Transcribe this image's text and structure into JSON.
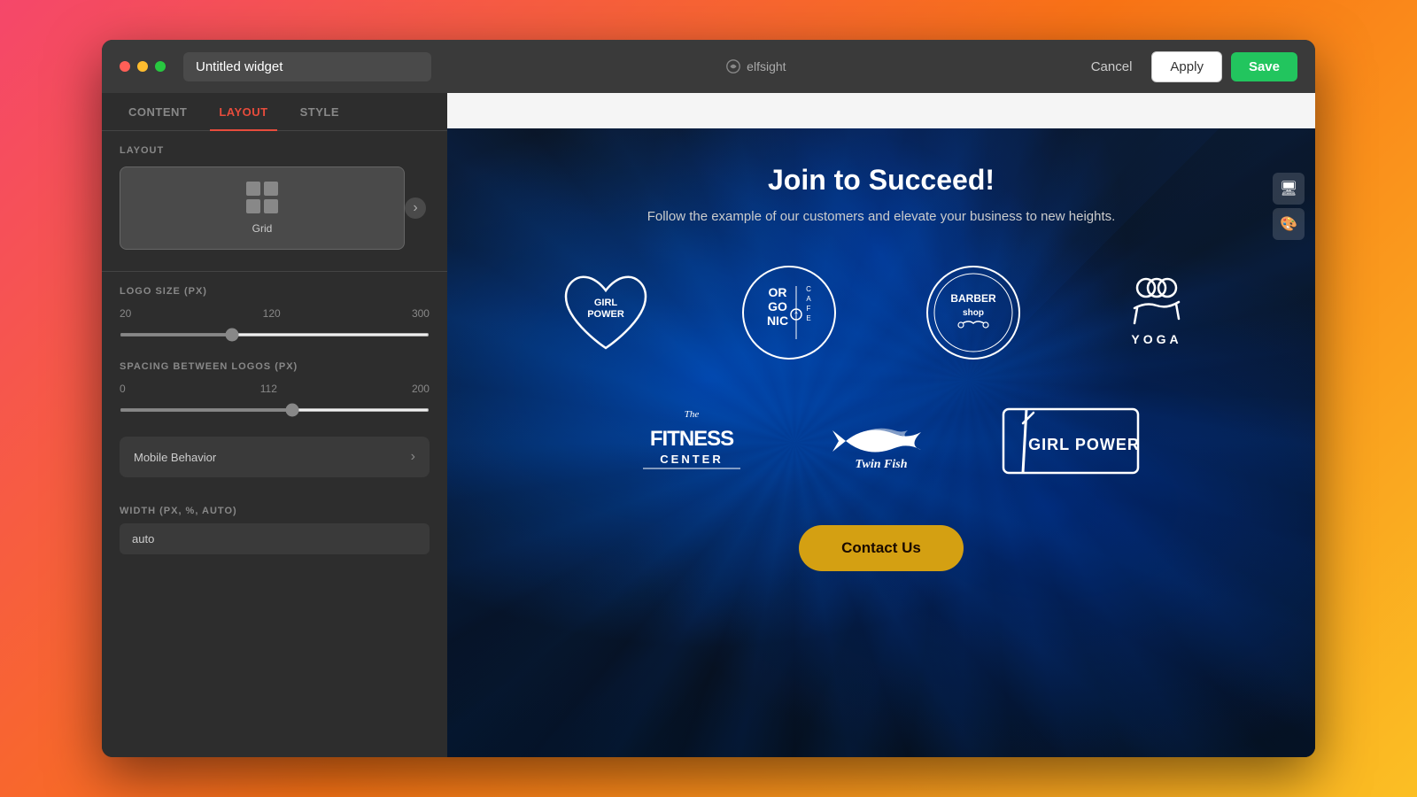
{
  "window": {
    "traffic_lights": [
      "close",
      "minimize",
      "fullscreen"
    ]
  },
  "header": {
    "widget_title": "Untitled widget",
    "widget_title_placeholder": "Untitled widget",
    "brand_name": "elfsight",
    "cancel_label": "Cancel",
    "apply_label": "Apply",
    "save_label": "Save"
  },
  "sidebar": {
    "tabs": [
      {
        "id": "content",
        "label": "CONTENT",
        "active": false
      },
      {
        "id": "layout",
        "label": "LAYOUT",
        "active": true
      },
      {
        "id": "style",
        "label": "STYLE",
        "active": false
      }
    ],
    "layout_section": {
      "label": "LAYOUT",
      "options": [
        {
          "id": "grid",
          "label": "Grid",
          "selected": true
        }
      ]
    },
    "logo_size": {
      "label": "LOGO SIZE (PX)",
      "min": 20,
      "current": 120,
      "max": 300
    },
    "spacing": {
      "label": "SPACING BETWEEN LOGOS (PX)",
      "min": 0,
      "current": 112,
      "max": 200
    },
    "mobile_behavior": {
      "label": "Mobile Behavior"
    },
    "width": {
      "label": "WIDTH (PX, %, AUTO)",
      "value": "auto"
    }
  },
  "preview": {
    "top_bar_bg": "#f5f5f5",
    "title": "Join to Succeed!",
    "subtitle": "Follow the example of our customers and elevate your business to new heights.",
    "contact_button": "Contact Us",
    "logos": [
      {
        "name": "Girl Power",
        "type": "heart-logo"
      },
      {
        "name": "Organic Cafe",
        "type": "organic-logo"
      },
      {
        "name": "Barber Shop",
        "type": "barber-logo"
      },
      {
        "name": "Yoga",
        "type": "yoga-logo"
      },
      {
        "name": "The Fitness Center",
        "type": "fitness-logo"
      },
      {
        "name": "Twin Fish",
        "type": "fish-logo"
      },
      {
        "name": "Girl Power Alt",
        "type": "gp-logo"
      }
    ]
  },
  "toolbar": {
    "desktop_icon": "🖥",
    "paint_icon": "🎨"
  }
}
